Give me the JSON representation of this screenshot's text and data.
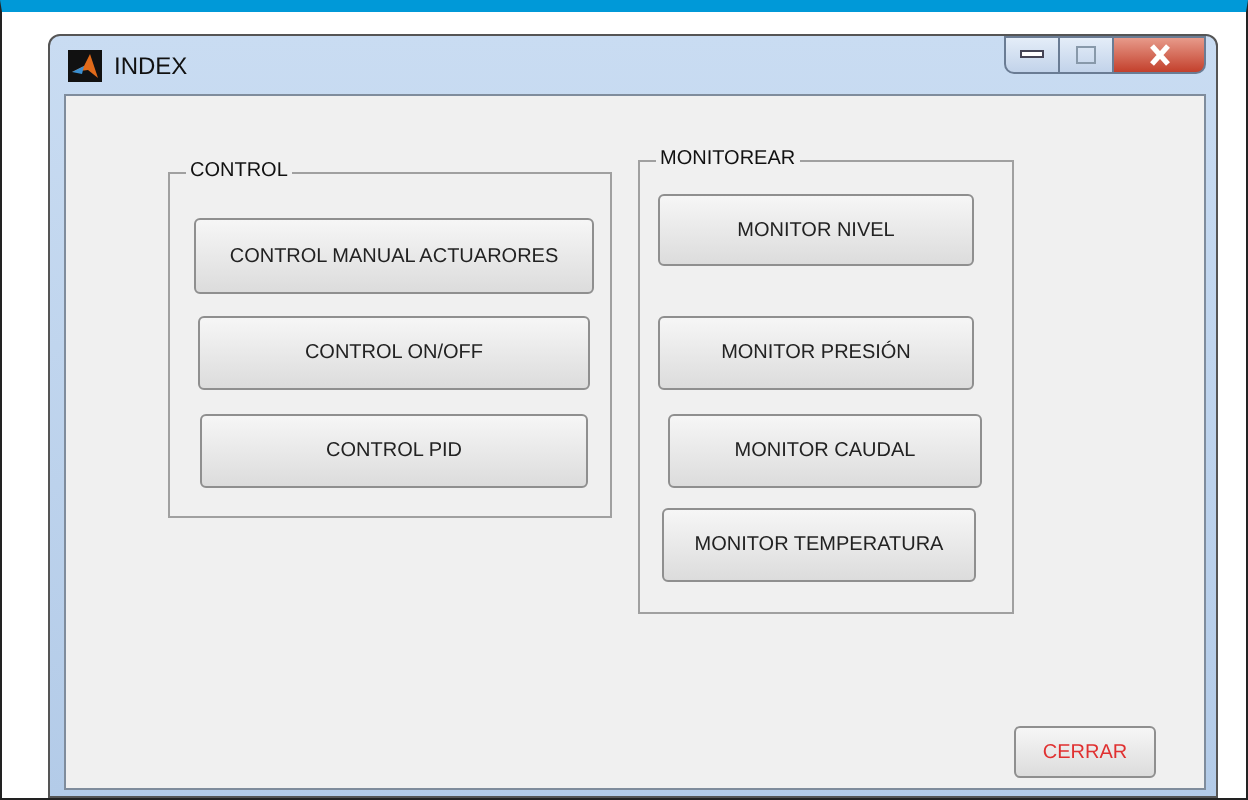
{
  "window": {
    "title": "INDEX"
  },
  "panels": [
    {
      "title": "CONTROL",
      "buttons": [
        "CONTROL MANUAL ACTUARORES",
        "CONTROL ON/OFF",
        "CONTROL PID"
      ]
    },
    {
      "title": "MONITOREAR",
      "buttons": [
        "MONITOR NIVEL",
        "MONITOR PRESIÓN",
        "MONITOR CAUDAL",
        "MONITOR TEMPERATURA"
      ]
    }
  ],
  "close_button": {
    "label": "CERRAR"
  }
}
